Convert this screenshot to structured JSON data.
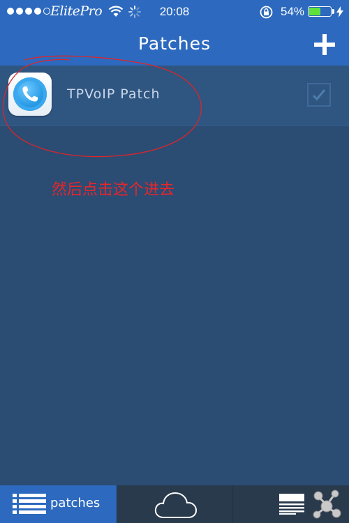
{
  "status_bar": {
    "carrier": "ElitePro",
    "time": "20:08",
    "battery_percent": "54%",
    "battery_level": 0.54,
    "signal_bars_filled": 4,
    "signal_bars_total": 5,
    "icons": [
      "signal-dots",
      "wifi-icon",
      "activity-spinner-icon",
      "rotation-lock-icon",
      "battery-icon",
      "charging-bolt-icon"
    ]
  },
  "nav": {
    "title": "Patches",
    "add_icon": "plus-icon"
  },
  "patches": [
    {
      "name": "TPVoIP Patch",
      "icon": "phone-app-icon",
      "enabled": true
    }
  ],
  "annotation": {
    "text": "然后点击这个进去",
    "color": "#e8262a"
  },
  "tabbar": {
    "tabs": [
      {
        "label": "patches",
        "icon": "list-icon",
        "selected": true
      },
      {
        "label": "",
        "icon": "cloud-icon",
        "selected": false
      },
      {
        "label": "",
        "icon": "document-icon",
        "selected": false
      }
    ]
  },
  "colors": {
    "accent": "#2d6abf",
    "background": "#2b4c73",
    "row": "#2f5581",
    "tabbar": "#2a3a4d"
  }
}
